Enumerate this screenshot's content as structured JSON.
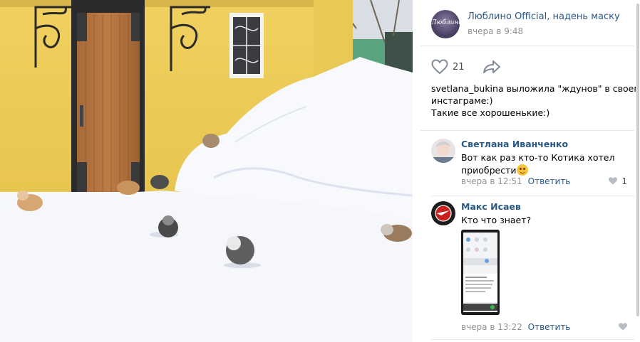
{
  "post": {
    "author": "Люблино Official, надень маску",
    "time": "вчера в 9:48",
    "avatar_text": "Люблино",
    "likes": "21",
    "text_lines": [
      "svetlana_bukina выложила \"ждунов\" в своем",
      "инстаграме:)",
      "Такие все хорошенькие:)"
    ]
  },
  "comments": [
    {
      "name": "Светлана Иванченко",
      "text_line1": "Вот как раз кто-то Котика хотел",
      "text_line2": "приобрести",
      "time": "вчера в 12:51",
      "reply": "Ответить",
      "likes": "1"
    },
    {
      "name": "Макс Исаев",
      "text_line1": "Кто что знает?",
      "time": "вчера в 13:22",
      "reply": "Ответить"
    }
  ],
  "colors": {
    "link": "#2a5885",
    "meta": "#939393",
    "divider": "#e7e8ec"
  },
  "icons": [
    "heart-icon",
    "share-arrow-icon",
    "emoji-smile-icon"
  ]
}
